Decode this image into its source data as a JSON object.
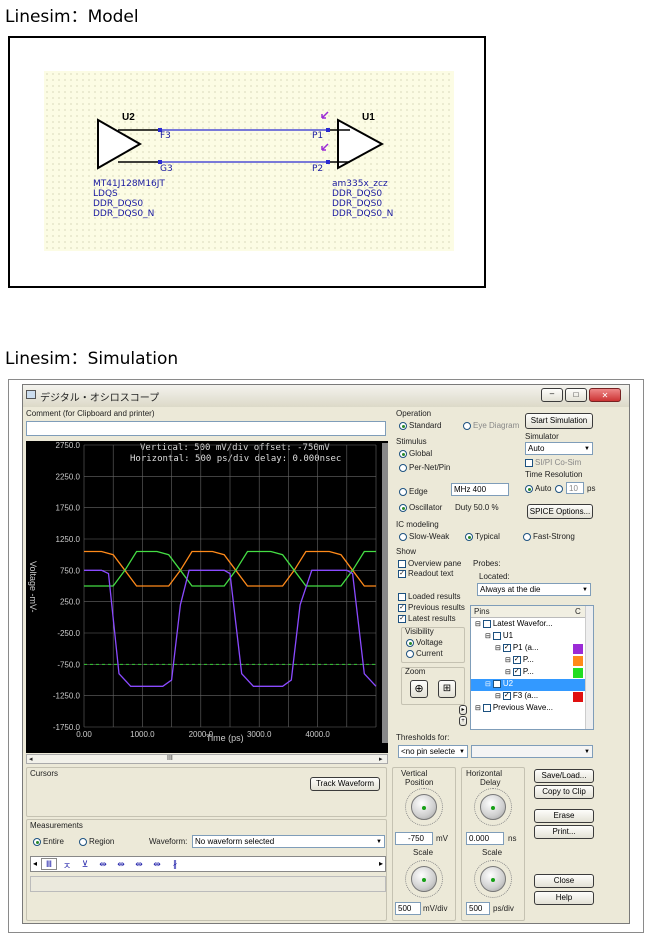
{
  "headings": {
    "model": "Linesim：Model",
    "simulation": "Linesim：Simulation"
  },
  "schematic": {
    "u2": {
      "label": "U2",
      "pin_top": "F3",
      "pin_bottom": "G3",
      "lines": [
        "MT41J128M16JT",
        "LDQS",
        "DDR_DQS0",
        "DDR_DQS0_N"
      ]
    },
    "u1": {
      "label": "U1",
      "pin_top": "P1",
      "pin_bottom": "P2",
      "lines": [
        "am335x_zcz",
        "DDR_DQS0",
        "DDR_DQS0",
        "DDR_DQS0_N"
      ]
    }
  },
  "window": {
    "title": "デジタル・オシロスコープ"
  },
  "comment": {
    "label": "Comment (for Clipboard and printer)",
    "value": ""
  },
  "scope": {
    "readout1": "Vertical: 500 mV/div  offset: -750mV",
    "readout2": "Horizontal: 500 ps/div  delay: 0.000nsec",
    "ylabel": "Voltage -mV-",
    "xlabel": "Time (ps)",
    "yticks": [
      "2750.0",
      "2250.0",
      "1750.0",
      "1250.0",
      "750.0",
      "250.0",
      "-250.0",
      "-750.0",
      "-1250.0",
      "-1750.0"
    ],
    "xticks": [
      "0.00",
      "1000.0",
      "2000.0",
      "3000.0",
      "4000.0"
    ],
    "scroll_marker": "III"
  },
  "chart_data": {
    "type": "line",
    "title": "",
    "xlabel": "Time (ps)",
    "ylabel": "Voltage -mV-",
    "xlim": [
      0,
      5000
    ],
    "ylim": [
      -1750,
      2750
    ],
    "grid": true,
    "series": [
      {
        "color": "#ff8a1a",
        "x": [
          0,
          300,
          500,
          700,
          900,
          1250,
          1450,
          1650,
          1850,
          2200,
          2400,
          2600,
          2800,
          3200,
          3400,
          3600,
          3800,
          4200,
          4400,
          4600,
          4800,
          5000
        ],
        "y": [
          1050,
          1050,
          1000,
          750,
          500,
          500,
          500,
          750,
          1050,
          1050,
          1000,
          750,
          500,
          500,
          500,
          750,
          1050,
          1050,
          1000,
          750,
          500,
          500
        ]
      },
      {
        "color": "#44dd44",
        "x": [
          0,
          300,
          500,
          700,
          900,
          1250,
          1450,
          1650,
          1850,
          2200,
          2400,
          2600,
          2800,
          3200,
          3400,
          3600,
          3800,
          4200,
          4400,
          4600,
          4800,
          5000
        ],
        "y": [
          500,
          500,
          500,
          750,
          1050,
          1050,
          1000,
          750,
          500,
          500,
          500,
          750,
          1050,
          1050,
          1000,
          750,
          500,
          500,
          500,
          750,
          1050,
          1050
        ]
      },
      {
        "color": "#8a4aff",
        "x": [
          0,
          300,
          420,
          600,
          800,
          1000,
          1350,
          1500,
          1650,
          1800,
          2000,
          2400,
          2500,
          2700,
          2900,
          3100,
          3400,
          3550,
          3700,
          3900,
          4100,
          4500,
          4600,
          4800,
          5000
        ],
        "y": [
          750,
          750,
          700,
          -900,
          -1100,
          -1100,
          -1100,
          -1000,
          200,
          750,
          750,
          750,
          700,
          -900,
          -1100,
          -1100,
          -1100,
          -1000,
          200,
          750,
          750,
          750,
          700,
          -900,
          -1100
        ]
      }
    ],
    "reference_line": -750
  },
  "operation": {
    "label": "Operation",
    "standard": "Standard",
    "eye": "Eye Diagram"
  },
  "stimulus": {
    "label": "Stimulus",
    "global": "Global",
    "pernet": "Per-Net/Pin",
    "edge": "Edge",
    "oscillator": "Oscillator",
    "mhz_value": "MHz 400",
    "duty_value": "Duty 50.0 %"
  },
  "simulator": {
    "start": "Start Simulation",
    "label": "Simulator",
    "value": "Auto",
    "cosim": "SI/PI Co-Sim",
    "time_res": "Time Resolution",
    "auto": "Auto",
    "ps_value": "10",
    "ps": "ps",
    "spice": "SPICE Options..."
  },
  "ic_modeling": {
    "label": "IC modeling",
    "slow": "Slow-Weak",
    "typical": "Typical",
    "fast": "Fast-Strong"
  },
  "show": {
    "label": "Show",
    "overview": "Overview pane",
    "readout": "Readout text",
    "loaded": "Loaded results",
    "previous": "Previous results",
    "latest": "Latest results"
  },
  "probes": {
    "label": "Probes:",
    "located": "Located:",
    "located_value": "Always at the die",
    "pins_header": "Pins",
    "pins_col": "C"
  },
  "tree": [
    {
      "text": "Latest Wavefor...",
      "indent": 0,
      "color": ""
    },
    {
      "text": "U1",
      "indent": 1,
      "color": ""
    },
    {
      "text": "P1 (a...",
      "indent": 2,
      "color": "#9b2bd6"
    },
    {
      "text": "P...",
      "indent": 3,
      "color": "#ff8a1a"
    },
    {
      "text": "P...",
      "indent": 3,
      "color": "#22dd22"
    },
    {
      "text": "U2",
      "indent": 1,
      "color": ""
    },
    {
      "text": "F3 (a...",
      "indent": 2,
      "color": "#e01010"
    },
    {
      "text": "Previous Wave...",
      "indent": 0,
      "color": ""
    }
  ],
  "visibility": {
    "label": "Visibility",
    "voltage": "Voltage",
    "current": "Current"
  },
  "zoom": {
    "label": "Zoom"
  },
  "thresholds": {
    "label": "Thresholds for:",
    "value": "<no pin selecte"
  },
  "cursors": {
    "label": "Cursors",
    "track": "Track Waveform"
  },
  "measurements": {
    "label": "Measurements",
    "entire": "Entire",
    "region": "Region",
    "waveform_label": "Waveform:",
    "waveform_value": "No waveform selected"
  },
  "vertical": {
    "label1": "Vertical",
    "label2": "Position",
    "pos_value": "-750",
    "pos_unit": "mV",
    "scale": "Scale",
    "scale_value": "500",
    "scale_unit": "mV/div"
  },
  "horizontal": {
    "label1": "Horizontal",
    "label2": "Delay",
    "delay_value": "0.000",
    "delay_unit": "ns",
    "scale": "Scale",
    "scale_value": "500",
    "scale_unit": "ps/div"
  },
  "buttons": {
    "save_load": "Save/Load...",
    "copy": "Copy to Clip",
    "erase": "Erase",
    "print": "Print...",
    "close": "Close",
    "help": "Help"
  },
  "meas_icons": [
    "Ⅲ",
    "ㅈ",
    "⊻",
    "⇹",
    "⇹",
    "⇹",
    "⇹",
    "∦"
  ]
}
